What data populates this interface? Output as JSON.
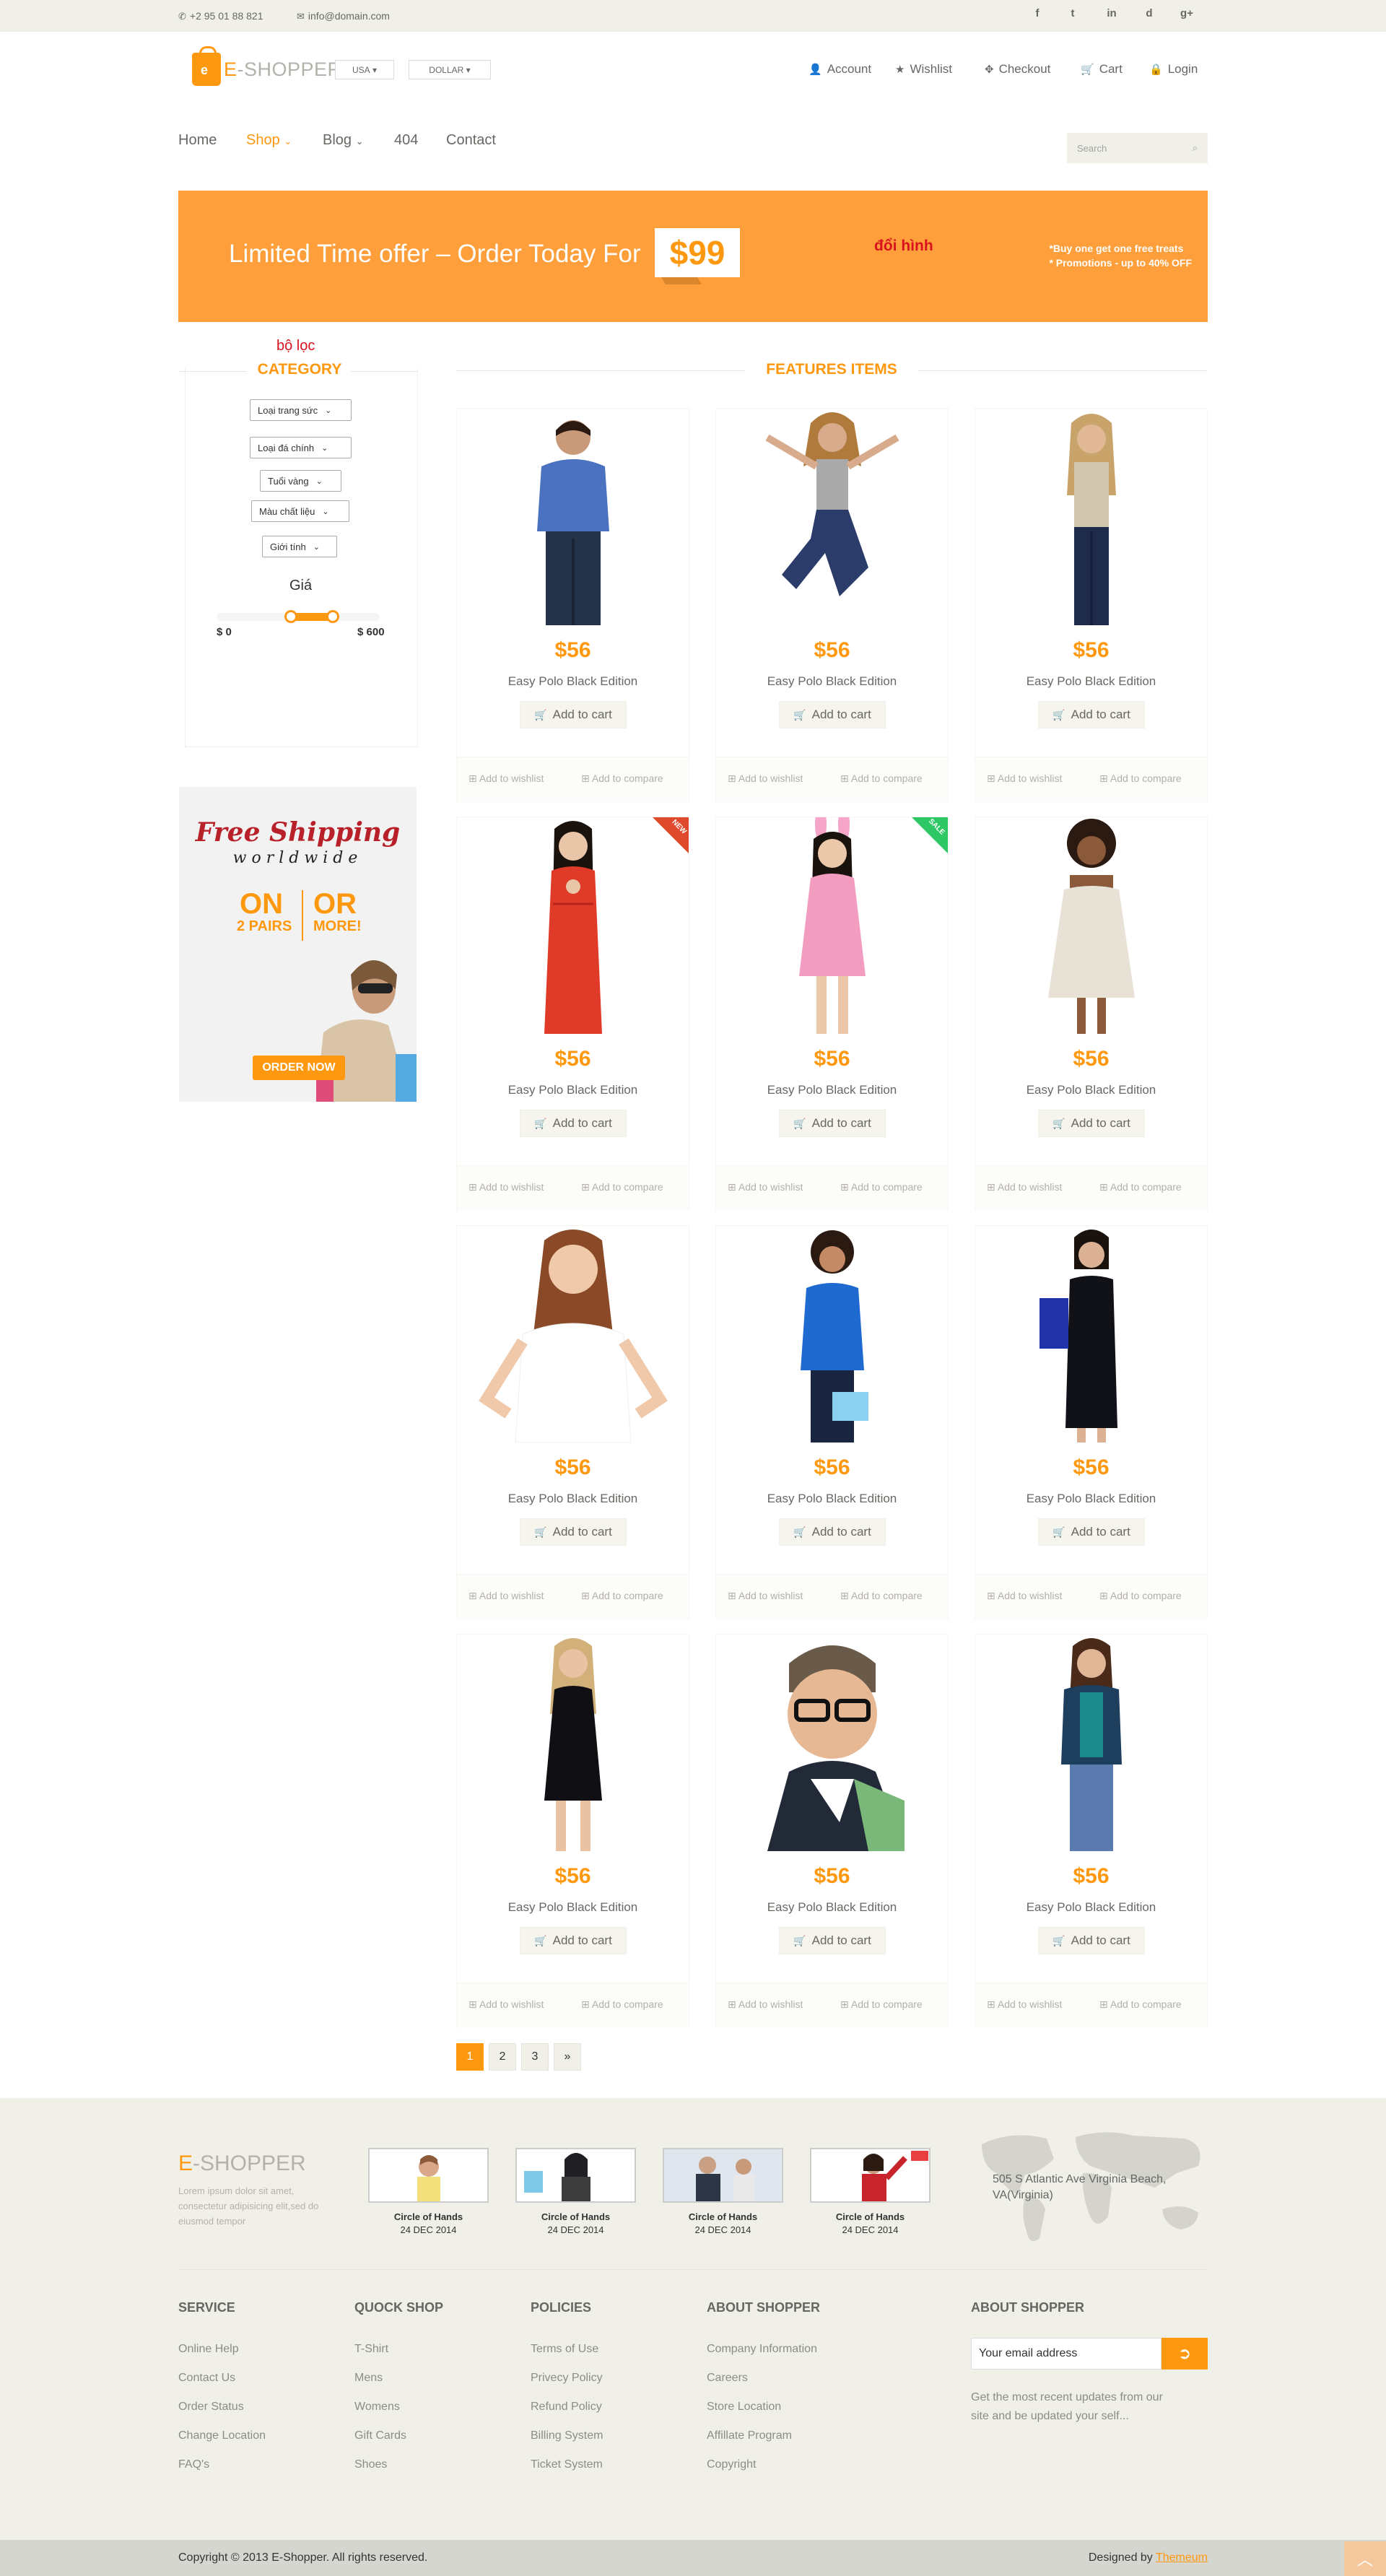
{
  "topbar": {
    "phone": "+2 95 01 88 821",
    "email": "info@domain.com",
    "social": [
      "f",
      "t",
      "in",
      "d",
      "g+"
    ]
  },
  "header": {
    "logo_e": "E",
    "logo_rest": "-SHOPPER",
    "country": "USA",
    "currency": "DOLLAR",
    "account_links": [
      "Account",
      "Wishlist",
      "Checkout",
      "Cart",
      "Login"
    ]
  },
  "nav": {
    "items": [
      "Home",
      "Shop",
      "Blog",
      "404",
      "Contact"
    ],
    "search_placeholder": "Search"
  },
  "banner": {
    "headline": "Limited Time offer – Order Today For",
    "price": "$99",
    "note": "đổi hình",
    "promo_1": "*Buy one get one free treats",
    "promo_2": "* Promotions - up to 40% OFF"
  },
  "sidebar": {
    "filter_label": "bộ lọc",
    "category_title": "CATEGORY",
    "filters": [
      "Loại trang sức",
      "Loại đá chính",
      "Tuổi vàng",
      "Màu chất liệu",
      "Giới tính"
    ],
    "price_title": "Giá",
    "price_min": "$ 0",
    "price_max": "$ 600",
    "ad": {
      "line1": "Free Shipping",
      "line2": "worldwide",
      "on": "ON",
      "pairs": "2 PAIRS",
      "or": "OR",
      "more": "MORE!",
      "cta": "ORDER NOW"
    }
  },
  "features": {
    "title": "FEATURES ITEMS",
    "add_to_cart": "Add to cart",
    "add_to_wishlist": "Add to wishlist",
    "add_to_compare": "Add to compare",
    "products": [
      {
        "price": "$56",
        "name": "Easy Polo Black Edition"
      },
      {
        "price": "$56",
        "name": "Easy Polo Black Edition"
      },
      {
        "price": "$56",
        "name": "Easy Polo Black Edition"
      },
      {
        "price": "$56",
        "name": "Easy Polo Black Edition",
        "badge": "NEW"
      },
      {
        "price": "$56",
        "name": "Easy Polo Black Edition",
        "badge": "SALE"
      },
      {
        "price": "$56",
        "name": "Easy Polo Black Edition"
      },
      {
        "price": "$56",
        "name": "Easy Polo Black Edition"
      },
      {
        "price": "$56",
        "name": "Easy Polo Black Edition"
      },
      {
        "price": "$56",
        "name": "Easy Polo Black Edition"
      },
      {
        "price": "$56",
        "name": "Easy Polo Black Edition"
      },
      {
        "price": "$56",
        "name": "Easy Polo Black Edition"
      },
      {
        "price": "$56",
        "name": "Easy Polo Black Edition"
      }
    ]
  },
  "pagination": [
    "1",
    "2",
    "3",
    "»"
  ],
  "footer": {
    "logo_e": "E",
    "logo_rest": "-SHOPPER",
    "description": "Lorem ipsum dolor sit amet, consectetur adipisicing elit,sed do eiusmod tempor",
    "videos": [
      {
        "title": "Circle of Hands",
        "date": "24 DEC 2014"
      },
      {
        "title": "Circle of Hands",
        "date": "24 DEC 2014"
      },
      {
        "title": "Circle of Hands",
        "date": "24 DEC 2014"
      },
      {
        "title": "Circle of Hands",
        "date": "24 DEC 2014"
      }
    ],
    "address": "505 S Atlantic Ave Virginia Beach, VA(Virginia)",
    "columns": [
      {
        "title": "SERVICE",
        "items": [
          "Online Help",
          "Contact Us",
          "Order Status",
          "Change Location",
          "FAQ's"
        ]
      },
      {
        "title": "QUOCK SHOP",
        "items": [
          "T-Shirt",
          "Mens",
          "Womens",
          "Gift Cards",
          "Shoes"
        ]
      },
      {
        "title": "POLICIES",
        "items": [
          "Terms of Use",
          "Privecy Policy",
          "Refund Policy",
          "Billing System",
          "Ticket System"
        ]
      },
      {
        "title": "ABOUT SHOPPER",
        "items": [
          "Company Information",
          "Careers",
          "Store Location",
          "Affillate Program",
          "Copyright"
        ]
      }
    ],
    "newsletter_title": "ABOUT SHOPPER",
    "email_placeholder": "Your email address",
    "newsletter_note": "Get the most recent updates from our site and be updated your self...",
    "copyright": "Copyright © 2013 E-Shopper. All rights reserved.",
    "designed_by": "Designed by",
    "designer": "Themeum"
  },
  "colors": {
    "accent": "#fe980f",
    "banner": "#fe9f3b",
    "footer_bg": "#f0f0e9"
  }
}
